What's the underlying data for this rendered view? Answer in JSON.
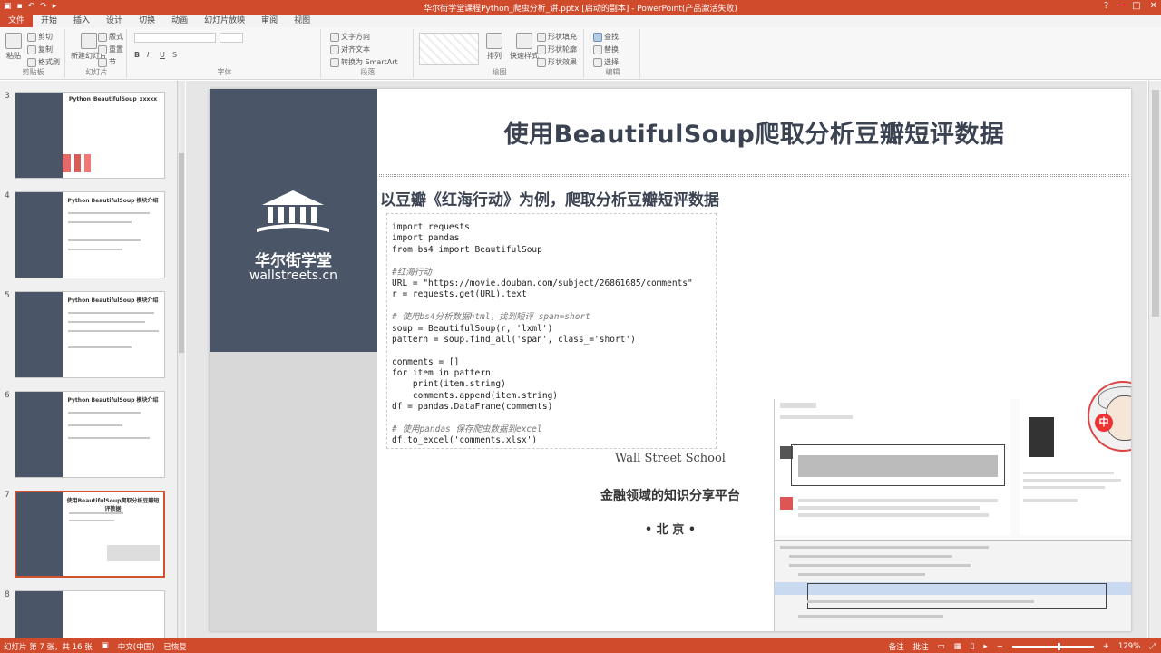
{
  "window": {
    "title": "华尔街学堂课程Python_爬虫分析_讲.pptx [启动的副本] - PowerPoint(产品激活失败)",
    "controls": [
      "?",
      "─",
      "□",
      "✕"
    ]
  },
  "menu_tabs": [
    "文件",
    "开始",
    "插入",
    "设计",
    "切换",
    "动画",
    "幻灯片放映",
    "审阅",
    "视图"
  ],
  "ribbon": {
    "clipboard": {
      "label": "剪贴板",
      "paste": "粘贴",
      "cut": "剪切",
      "copy": "复制",
      "format_painter": "格式刷"
    },
    "slides": {
      "label": "幻灯片",
      "new_slide": "新建幻灯片",
      "layout": "版式",
      "reset": "重置",
      "section": "节"
    },
    "font": {
      "label": "字体",
      "bold": "B",
      "italic": "I",
      "underline": "U",
      "strike": "S"
    },
    "paragraph": {
      "label": "段落",
      "text_direction": "文字方向",
      "align_text": "对齐文本",
      "smartart": "转换为 SmartArt"
    },
    "drawing": {
      "label": "绘图",
      "arrange": "排列",
      "quick_styles": "快速样式",
      "shape_fill": "形状填充",
      "shape_outline": "形状轮廓",
      "shape_effects": "形状效果"
    },
    "editing": {
      "label": "编辑",
      "find": "查找",
      "replace": "替换",
      "select": "选择"
    }
  },
  "thumbnails": [
    {
      "num": "3",
      "title": "Python_BeautifulSoup_xxxxx",
      "selected": false
    },
    {
      "num": "4",
      "title": "Python BeautifulSoup 模块介绍",
      "selected": false
    },
    {
      "num": "5",
      "title": "Python BeautifulSoup 模块介绍",
      "selected": false
    },
    {
      "num": "6",
      "title": "Python BeautifulSoup 模块介绍",
      "selected": false
    },
    {
      "num": "7",
      "title": "使用BeautifulSoup爬取分析豆瓣短评数据",
      "selected": true
    },
    {
      "num": "8",
      "title": "",
      "selected": false
    }
  ],
  "slide": {
    "title": "使用BeautifulSoup爬取分析豆瓣短评数据",
    "subtitle": "以豆瓣《红海行动》为例，爬取分析豆瓣短评数据",
    "brand_cn": "华尔街学堂",
    "brand_en": "wallstreets.cn",
    "school": "Wall Street School",
    "platform": "金融领域的知识分享平台",
    "city": "• 北 京 •",
    "code": [
      {
        "text": "import requests",
        "comment": false
      },
      {
        "text": "import pandas",
        "comment": false
      },
      {
        "text": "from bs4 import BeautifulSoup",
        "comment": false
      },
      {
        "text": "",
        "comment": false
      },
      {
        "text": "#红海行动",
        "comment": true
      },
      {
        "text": "URL = \"https://movie.douban.com/subject/26861685/comments\"",
        "comment": false
      },
      {
        "text": "r = requests.get(URL).text",
        "comment": false
      },
      {
        "text": "",
        "comment": false
      },
      {
        "text": "# 使用bs4分析数据html，找到短评 span=short",
        "comment": true
      },
      {
        "text": "soup = BeautifulSoup(r, 'lxml')",
        "comment": false
      },
      {
        "text": "pattern = soup.find_all('span', class_='short')",
        "comment": false
      },
      {
        "text": "",
        "comment": false
      },
      {
        "text": "comments = []",
        "comment": false
      },
      {
        "text": "for item in pattern:",
        "comment": false
      },
      {
        "text": "    print(item.string)",
        "comment": false
      },
      {
        "text": "    comments.append(item.string)",
        "comment": false
      },
      {
        "text": "df = pandas.DataFrame(comments)",
        "comment": false
      },
      {
        "text": "",
        "comment": false
      },
      {
        "text": "# 使用pandas 保存爬虫数据到excel",
        "comment": true
      },
      {
        "text": "df.to_excel('comments.xlsx')",
        "comment": false
      }
    ],
    "avatar_badge": "中"
  },
  "status": {
    "slide_info": "幻灯片 第 7 张，共 16 张",
    "language": "中文(中国)",
    "recovered": "已恢复",
    "notes": "备注",
    "comments": "批注",
    "zoom": "129%"
  }
}
